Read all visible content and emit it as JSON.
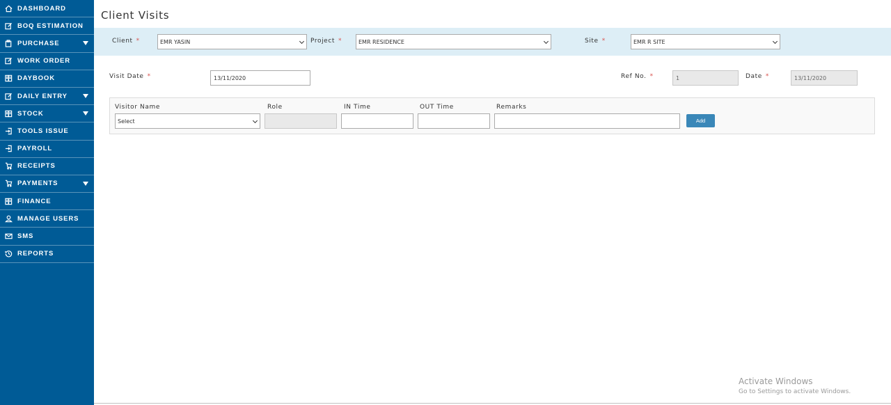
{
  "sidebar": {
    "items": [
      {
        "label": "DASHBOARD",
        "icon": "home-icon",
        "has_submenu": false
      },
      {
        "label": "BOQ ESTIMATION",
        "icon": "edit-icon",
        "has_submenu": false
      },
      {
        "label": "PURCHASE",
        "icon": "clipboard-icon",
        "has_submenu": true
      },
      {
        "label": "WORK ORDER",
        "icon": "edit-icon",
        "has_submenu": false
      },
      {
        "label": "DAYBOOK",
        "icon": "book-icon",
        "has_submenu": false
      },
      {
        "label": "DAILY ENTRY",
        "icon": "edit-icon",
        "has_submenu": true
      },
      {
        "label": "STOCK",
        "icon": "book-icon",
        "has_submenu": true
      },
      {
        "label": "TOOLS ISSUE",
        "icon": "sign-in-icon",
        "has_submenu": false
      },
      {
        "label": "PAYROLL",
        "icon": "sign-in-icon",
        "has_submenu": false
      },
      {
        "label": "RECEIPTS",
        "icon": "cart-icon",
        "has_submenu": false
      },
      {
        "label": "PAYMENTS",
        "icon": "cart-icon",
        "has_submenu": true
      },
      {
        "label": "FINANCE",
        "icon": "book-icon",
        "has_submenu": false
      },
      {
        "label": "MANAGE USERS",
        "icon": "user-icon",
        "has_submenu": false
      },
      {
        "label": "SMS",
        "icon": "mail-icon",
        "has_submenu": false
      },
      {
        "label": "REPORTS",
        "icon": "history-icon",
        "has_submenu": false
      }
    ]
  },
  "page": {
    "title": "Client Visits"
  },
  "filters": {
    "client_label": "Client",
    "client_value": "EMR YASIN",
    "project_label": "Project",
    "project_value": "EMR RESIDENCE",
    "site_label": "Site",
    "site_value": "EMR R SITE",
    "required_marker": "*"
  },
  "form": {
    "visit_date_label": "Visit Date",
    "visit_date_value": "13/11/2020",
    "ref_no_label": "Ref No.",
    "ref_no_value": "1",
    "date_label": "Date",
    "date_value": "13/11/2020"
  },
  "visitor": {
    "name_label": "Visitor Name",
    "name_value": "Select",
    "role_label": "Role",
    "role_value": "",
    "in_time_label": "IN Time",
    "out_time_label": "OUT Time",
    "remarks_label": "Remarks",
    "add_label": "Add"
  },
  "watermark": {
    "title": "Activate Windows",
    "subtitle": "Go to Settings to activate Windows."
  },
  "colors": {
    "sidebar_bg": "#005b96",
    "filter_bar_bg": "#ddeef6",
    "add_button_bg": "#3a87b8",
    "required_marker": "#d9534f"
  }
}
